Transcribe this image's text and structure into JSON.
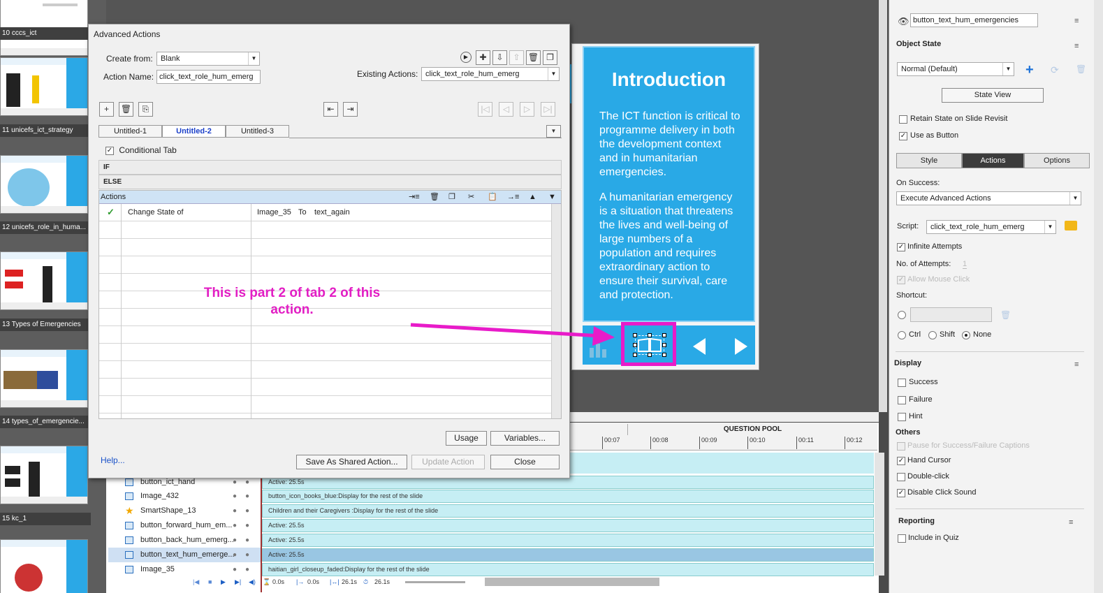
{
  "filmstrip": {
    "slides": [
      {
        "label": "10 cccs_ict"
      },
      {
        "label": "11 unicefs_ict_strategy"
      },
      {
        "label": "12 unicefs_role_in_huma..."
      },
      {
        "label": "13 Types of Emergencies"
      },
      {
        "label": "14 types_of_emergencie..."
      },
      {
        "label": "15 kc_1"
      }
    ]
  },
  "slide": {
    "title": "Introduction",
    "body_p1": "The ICT function is critical to programme delivery in both the development context and in humanitarian emergencies.",
    "body_p2": "A humanitarian emergency is a situation that threatens the lives and well-being of large numbers of a population and requires extraordinary action to ensure their survival, care and protection."
  },
  "dialog": {
    "title": "Advanced Actions",
    "create_from_label": "Create from:",
    "create_from_value": "Blank",
    "action_name_label": "Action Name:",
    "action_name_value": "click_text_role_hum_emerg",
    "existing_actions_label": "Existing Actions:",
    "existing_actions_value": "click_text_role_hum_emerg",
    "tabs": [
      {
        "label": "Untitled-1"
      },
      {
        "label": "Untitled-2"
      },
      {
        "label": "Untitled-3"
      }
    ],
    "conditional_tab_label": "Conditional Tab",
    "if_label": "IF",
    "else_label": "ELSE",
    "actions_header": "Actions",
    "action_row": {
      "command": "Change State of",
      "target": "Image_35",
      "to": "To",
      "state": "text_again"
    },
    "usage_button": "Usage",
    "variables_button": "Variables...",
    "help_link": "Help...",
    "save_shared_button": "Save As Shared Action...",
    "update_button": "Update Action",
    "close_button": "Close"
  },
  "annotation": {
    "line1": "This is part 2 of tab 2 of this",
    "line2": "action.",
    "color": "#e21ec4"
  },
  "timeline": {
    "question_pool": "QUESTION POOL",
    "ticks": [
      "00:07",
      "00:08",
      "00:09",
      "00:10",
      "00:11",
      "00:12"
    ],
    "rows": [
      {
        "name": "button_ict_hand",
        "bar": "Active: 25.5s"
      },
      {
        "name": "Image_432",
        "bar": "button_icon_books_blue:Display for the rest of the slide"
      },
      {
        "name": "SmartShape_13",
        "bar": "Children and their Caregivers :Display for the rest of the slide"
      },
      {
        "name": "button_forward_hum_em...",
        "bar": "Active: 25.5s"
      },
      {
        "name": "button_back_hum_emerg...",
        "bar": "Active: 25.5s"
      },
      {
        "name": "button_text_hum_emerge...",
        "bar": "Active: 25.5s"
      },
      {
        "name": "Image_35",
        "bar": "haitian_girl_closeup_faded:Display for the rest of the slide"
      }
    ],
    "status": {
      "t1": "0.0s",
      "t2": "0.0s",
      "t3": "26.1s",
      "t4": "26.1s"
    }
  },
  "props": {
    "object_name": "button_text_hum_emergencies",
    "object_state_heading": "Object State",
    "state_value": "Normal (Default)",
    "state_view_button": "State View",
    "retain_state": "Retain State on Slide Revisit",
    "use_as_button": "Use as Button",
    "tabs": [
      {
        "label": "Style"
      },
      {
        "label": "Actions"
      },
      {
        "label": "Options"
      }
    ],
    "on_success_label": "On Success:",
    "on_success_value": "Execute Advanced Actions",
    "script_label": "Script:",
    "script_value": "click_text_role_hum_emerg",
    "infinite_attempts": "Infinite Attempts",
    "num_attempts_label": "No. of Attempts:",
    "num_attempts_value": "1",
    "allow_mouse_click": "Allow Mouse Click",
    "shortcut_label": "Shortcut:",
    "ctrl": "Ctrl",
    "shift": "Shift",
    "none": "None",
    "display_heading": "Display",
    "success": "Success",
    "failure": "Failure",
    "hint": "Hint",
    "others_heading": "Others",
    "pause_captions": "Pause for Success/Failure Captions",
    "hand_cursor": "Hand Cursor",
    "double_click": "Double-click",
    "disable_click_sound": "Disable Click Sound",
    "reporting_heading": "Reporting",
    "include_in_quiz": "Include in Quiz"
  }
}
